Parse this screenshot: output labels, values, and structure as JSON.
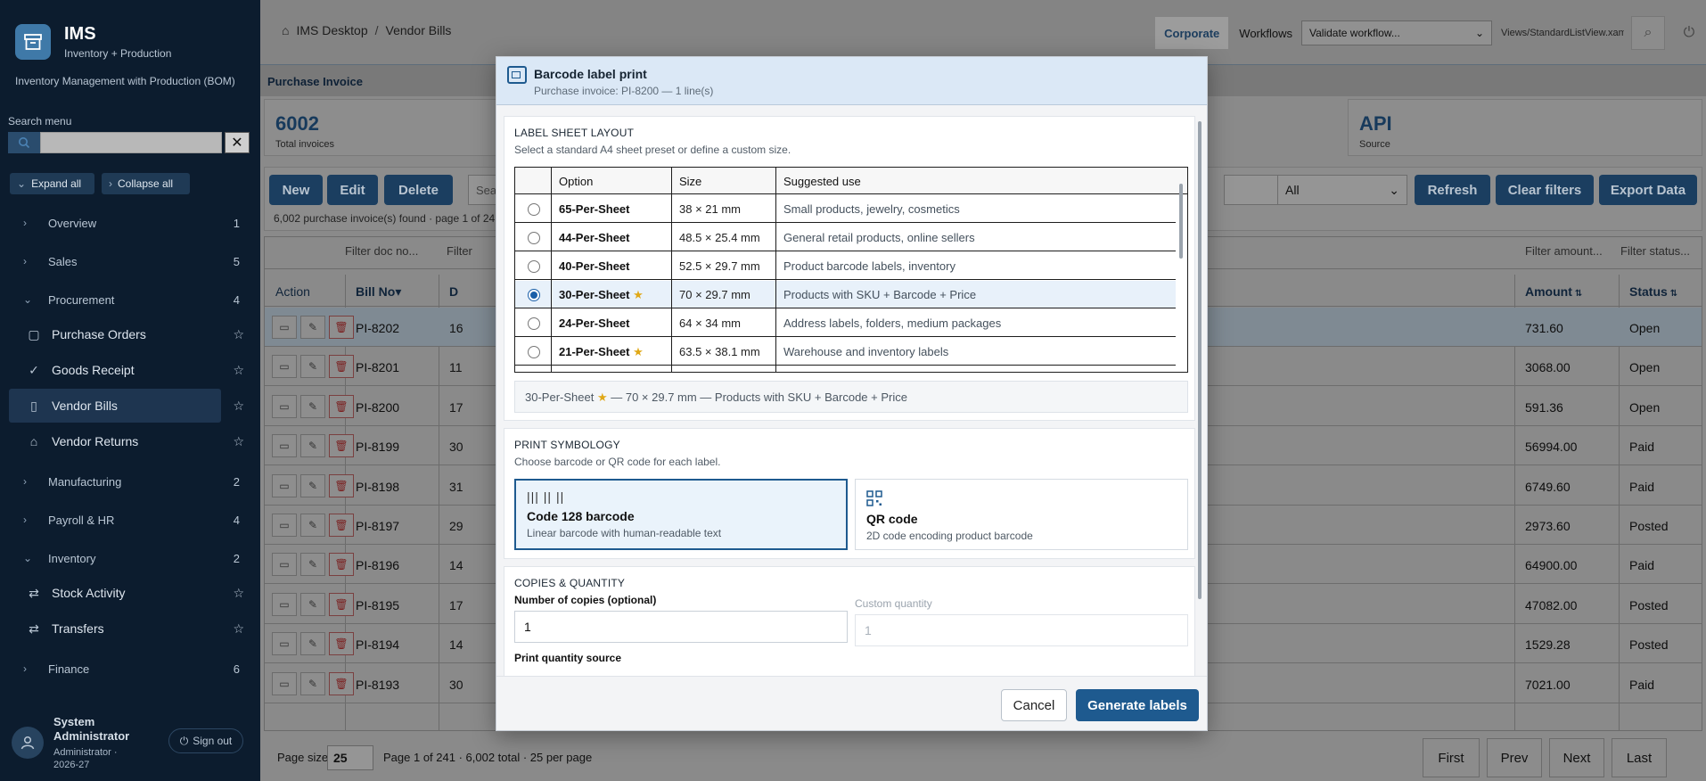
{
  "app": {
    "name": "IMS",
    "subtitle": "Inventory + Production",
    "description": "Inventory Management with Production (BOM)"
  },
  "sidebar": {
    "search_label": "Search menu",
    "search_placeholder": "",
    "clear_symbol": "✕",
    "expand_all": "Expand all",
    "collapse_all": "Collapse all",
    "groups": [
      {
        "label": "Overview",
        "count": "1",
        "expanded": false
      },
      {
        "label": "Sales",
        "count": "5",
        "expanded": false
      },
      {
        "label": "Procurement",
        "count": "4",
        "expanded": true
      },
      {
        "label": "Manufacturing",
        "count": "2",
        "expanded": false
      },
      {
        "label": "Payroll & HR",
        "count": "4",
        "expanded": false
      },
      {
        "label": "Inventory",
        "count": "2",
        "expanded": true
      },
      {
        "label": "Finance",
        "count": "6",
        "expanded": false
      }
    ],
    "items": [
      {
        "label": "Purchase Orders",
        "icon": "clipboard-icon"
      },
      {
        "label": "Goods Receipt",
        "icon": "check-icon"
      },
      {
        "label": "Vendor Bills",
        "icon": "document-icon",
        "active": true
      },
      {
        "label": "Vendor Returns",
        "icon": "home-icon"
      },
      {
        "label": "Stock Activity",
        "icon": "transfer-icon"
      },
      {
        "label": "Transfers",
        "icon": "transfer-icon"
      }
    ],
    "user": {
      "name": "System Administrator",
      "role": "Administrator · 2026-27",
      "sign_out": "Sign out"
    }
  },
  "topbar": {
    "home": "IMS Desktop",
    "separator": "/",
    "current": "Vendor Bills",
    "company": "Corporate",
    "workflows_label": "Workflows",
    "workflow_value": "Validate workflow...",
    "view_path": "Views/StandardListView.xaml"
  },
  "page": {
    "title": "Purchase Invoice",
    "stats": [
      {
        "value": "6002",
        "label": "Total invoices"
      },
      {
        "value": "API",
        "label": "Source"
      }
    ],
    "toolbar": {
      "new": "New",
      "edit": "Edit",
      "delete": "Delete",
      "search_placeholder": "Sear",
      "status_filter": "All",
      "refresh": "Refresh",
      "clear_filters": "Clear filters",
      "export": "Export Data"
    },
    "found_text": "6,002 purchase invoice(s) found · page 1 of 24",
    "filters": {
      "doc_no": "Filter doc no...",
      "date": "Filter",
      "amount": "Filter amount...",
      "status": "Filter status..."
    },
    "columns": {
      "action": "Action",
      "bill_no": "Bill No",
      "date": "D",
      "amount": "Amount",
      "status": "Status"
    },
    "rows": [
      {
        "bill": "PI-8202",
        "date": "16",
        "amount": "731.60",
        "status": "Open"
      },
      {
        "bill": "PI-8201",
        "date": "11",
        "amount": "3068.00",
        "status": "Open"
      },
      {
        "bill": "PI-8200",
        "date": "17",
        "amount": "591.36",
        "status": "Open"
      },
      {
        "bill": "PI-8199",
        "date": "30",
        "amount": "56994.00",
        "status": "Paid"
      },
      {
        "bill": "PI-8198",
        "date": "31",
        "amount": "6749.60",
        "status": "Paid"
      },
      {
        "bill": "PI-8197",
        "date": "29",
        "amount": "2973.60",
        "status": "Posted"
      },
      {
        "bill": "PI-8196",
        "date": "14",
        "amount": "64900.00",
        "status": "Paid"
      },
      {
        "bill": "PI-8195",
        "date": "17",
        "amount": "47082.00",
        "status": "Posted"
      },
      {
        "bill": "PI-8194",
        "date": "14",
        "amount": "1529.28",
        "status": "Posted"
      },
      {
        "bill": "PI-8193",
        "date": "30",
        "amount": "7021.00",
        "status": "Paid"
      }
    ],
    "pager": {
      "size_label": "Page size",
      "size_value": "25",
      "info": "Page 1 of 241 · 6,002 total · 25 per page",
      "first": "First",
      "prev": "Prev",
      "next": "Next",
      "last": "Last"
    }
  },
  "modal": {
    "title": "Barcode label print",
    "subtitle": "Purchase invoice: PI-8200 — 1 line(s)",
    "layout": {
      "title": "LABEL SHEET LAYOUT",
      "desc": "Select a standard A4 sheet preset or define a custom size.",
      "col_option": "Option",
      "col_size": "Size",
      "col_use": "Suggested use",
      "rows": [
        {
          "option": "65-Per-Sheet",
          "star": false,
          "size": "38 × 21 mm",
          "use": "Small products, jewelry, cosmetics"
        },
        {
          "option": "44-Per-Sheet",
          "star": false,
          "size": "48.5 × 25.4 mm",
          "use": "General retail products, online sellers"
        },
        {
          "option": "40-Per-Sheet",
          "star": false,
          "size": "52.5 × 29.7 mm",
          "use": "Product barcode labels, inventory"
        },
        {
          "option": "30-Per-Sheet",
          "star": true,
          "size": "70 × 29.7 mm",
          "use": "Products with SKU + Barcode + Price",
          "selected": true
        },
        {
          "option": "24-Per-Sheet",
          "star": false,
          "size": "64 × 34 mm",
          "use": "Address labels, folders, medium packages"
        },
        {
          "option": "21-Per-Sheet",
          "star": true,
          "size": "63.5 × 38.1 mm",
          "use": "Warehouse and inventory labels"
        }
      ],
      "summary_option": "30-Per-Sheet",
      "summary_rest": " — 70 × 29.7 mm — Products with SKU + Barcode + Price"
    },
    "symbology": {
      "title": "PRINT SYMBOLOGY",
      "desc": "Choose barcode or QR code for each label.",
      "code128_glyph": "||| || ||",
      "code128_name": "Code 128 barcode",
      "code128_desc": "Linear barcode with human-readable text",
      "qr_name": "QR code",
      "qr_desc": "2D code encoding product barcode"
    },
    "copies": {
      "title": "COPIES & QUANTITY",
      "copies_label": "Number of copies (optional)",
      "copies_value": "1",
      "custom_label": "Custom quantity",
      "custom_value": "1",
      "source_label": "Print quantity source"
    },
    "cancel": "Cancel",
    "generate": "Generate labels"
  }
}
